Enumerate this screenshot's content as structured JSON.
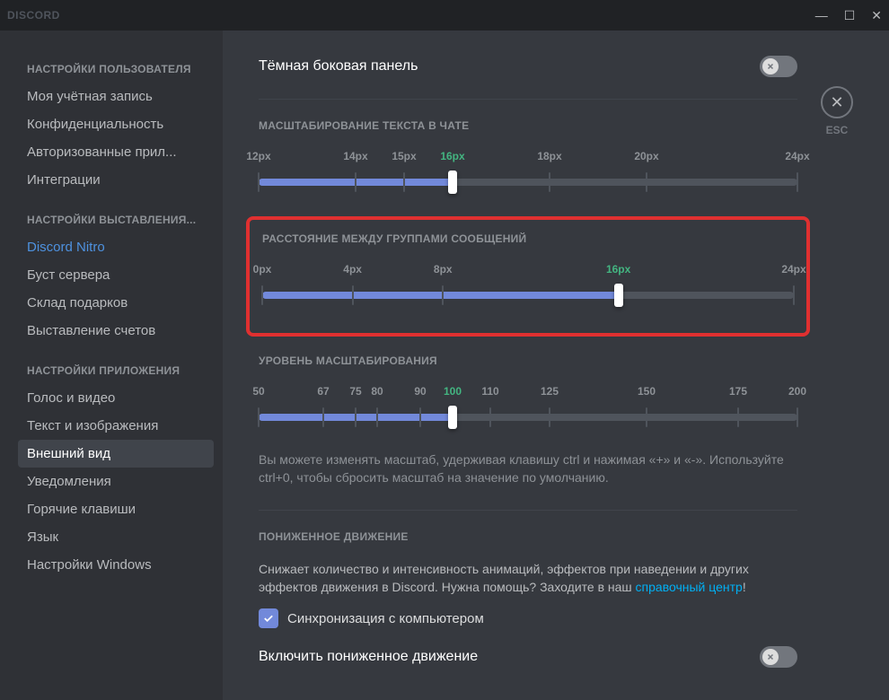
{
  "titlebar": {
    "logo": "DISCORD"
  },
  "esc": {
    "label": "ESC"
  },
  "sidebar": {
    "headers": {
      "user": "НАСТРОЙКИ ПОЛЬЗОВАТЕЛЯ",
      "billing": "НАСТРОЙКИ ВЫСТАВЛЕНИЯ...",
      "app": "НАСТРОЙКИ ПРИЛОЖЕНИЯ"
    },
    "items": {
      "account": "Моя учётная запись",
      "privacy": "Конфиденциальность",
      "authorized": "Авторизованные прил...",
      "integrations": "Интеграции",
      "nitro": "Discord Nitro",
      "boost": "Буст сервера",
      "gifts": "Склад подарков",
      "billing": "Выставление счетов",
      "voice": "Голос и видео",
      "text": "Текст и изображения",
      "appearance": "Внешний вид",
      "notifications": "Уведомления",
      "hotkeys": "Горячие клавиши",
      "language": "Язык",
      "windows": "Настройки Windows"
    }
  },
  "content": {
    "dark_sidebar": {
      "title": "Тёмная боковая панель"
    },
    "text_scale": {
      "title": "МАСШТАБИРОВАНИЕ ТЕКСТА В ЧАТЕ",
      "ticks": [
        {
          "pos": 0,
          "label": "12px"
        },
        {
          "pos": 18,
          "label": "14px"
        },
        {
          "pos": 27,
          "label": "15px"
        },
        {
          "pos": 36,
          "label": "16px",
          "active": true
        },
        {
          "pos": 54,
          "label": "18px"
        },
        {
          "pos": 72,
          "label": "20px"
        },
        {
          "pos": 100,
          "label": "24px"
        }
      ],
      "value_pct": 36
    },
    "group_spacing": {
      "title": "РАССТОЯНИЕ МЕЖДУ ГРУППАМИ СООБЩЕНИЙ",
      "ticks": [
        {
          "pos": 0,
          "label": "0px"
        },
        {
          "pos": 17,
          "label": "4px"
        },
        {
          "pos": 34,
          "label": "8px"
        },
        {
          "pos": 67,
          "label": "16px",
          "active": true
        },
        {
          "pos": 100,
          "label": "24px"
        }
      ],
      "value_pct": 67
    },
    "zoom": {
      "title": "УРОВЕНЬ МАСШТАБИРОВАНИЯ",
      "ticks": [
        {
          "pos": 0,
          "label": "50"
        },
        {
          "pos": 12,
          "label": "67"
        },
        {
          "pos": 18,
          "label": "75"
        },
        {
          "pos": 22,
          "label": "80"
        },
        {
          "pos": 30,
          "label": "90"
        },
        {
          "pos": 36,
          "label": "100",
          "active": true
        },
        {
          "pos": 43,
          "label": "110"
        },
        {
          "pos": 54,
          "label": "125"
        },
        {
          "pos": 72,
          "label": "150"
        },
        {
          "pos": 89,
          "label": "175"
        },
        {
          "pos": 100,
          "label": "200"
        }
      ],
      "value_pct": 36,
      "help": "Вы можете изменять масштаб, удерживая клавишу ctrl и нажимая «+» и «-». Используйте ctrl+0, чтобы сбросить масштаб на значение по умолчанию."
    },
    "reduced_motion": {
      "title": "ПОНИЖЕННОЕ ДВИЖЕНИЕ",
      "desc_pre": "Снижает количество и интенсивность анимаций, эффектов при наведении и других эффектов движения в Discord. Нужна помощь? Заходите в наш ",
      "desc_link": "справочный центр",
      "desc_post": "!",
      "checkbox_label": "Синхронизация с компьютером",
      "enable_label": "Включить пониженное движение"
    }
  }
}
